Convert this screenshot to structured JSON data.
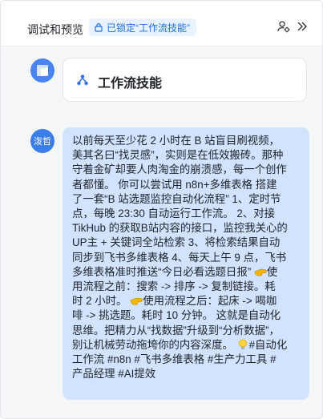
{
  "header": {
    "title": "调试和预览",
    "lock_badge": "已锁定“工作流技能”"
  },
  "bot": {
    "skill_label": "工作流技能"
  },
  "user": {
    "avatar_text": "泼哲",
    "message_lines": [
      "以前每天至少花 2 小时在 B 站盲目刷视频，",
      "美其名曰“找灵感”，实则是在低效搬砖。那种",
      "守着金矿却要人肉淘金的崩溃感，每一个创作",
      "者都懂。 你可以尝试用 n8n+多维表格 搭建",
      "了一套“B 站选题监控自动化流程” 1、定时节",
      "点，每晚 23:30 自动运行工作流。 2、对接",
      "TikHub 的获取B站内容的接口，监控我关心的",
      "UP主 + 关键词全站检索 3、将检索结果自动",
      "同步到飞书多维表格 4、每天上午 9 点，飞书",
      "多维表格准时推送“今日必看选题日报” ",
      "用流程之前：搜索 -> 排序 -> 复制链接。耗",
      "时 2 小时。",
      "啡 -> 挑选题。耗时 10 分钟。 这就是自动化",
      "思维。把精力从“找数据”升级到“分析数据”，",
      "别让机械劳动拖垮你的内容深度。 ",
      "工作流 #n8n #飞书多维表格 #生产力工具 #",
      "产品经理 #AI提效"
    ],
    "tail_l10": "使",
    "tail_l12": "使用流程之后：起床 -> 喝咖",
    "tail_l15": "#自动化"
  },
  "colors": {
    "accent": "#1b6fe8",
    "bubble": "#d1e3ff",
    "avatar": "#3b7ee9"
  }
}
